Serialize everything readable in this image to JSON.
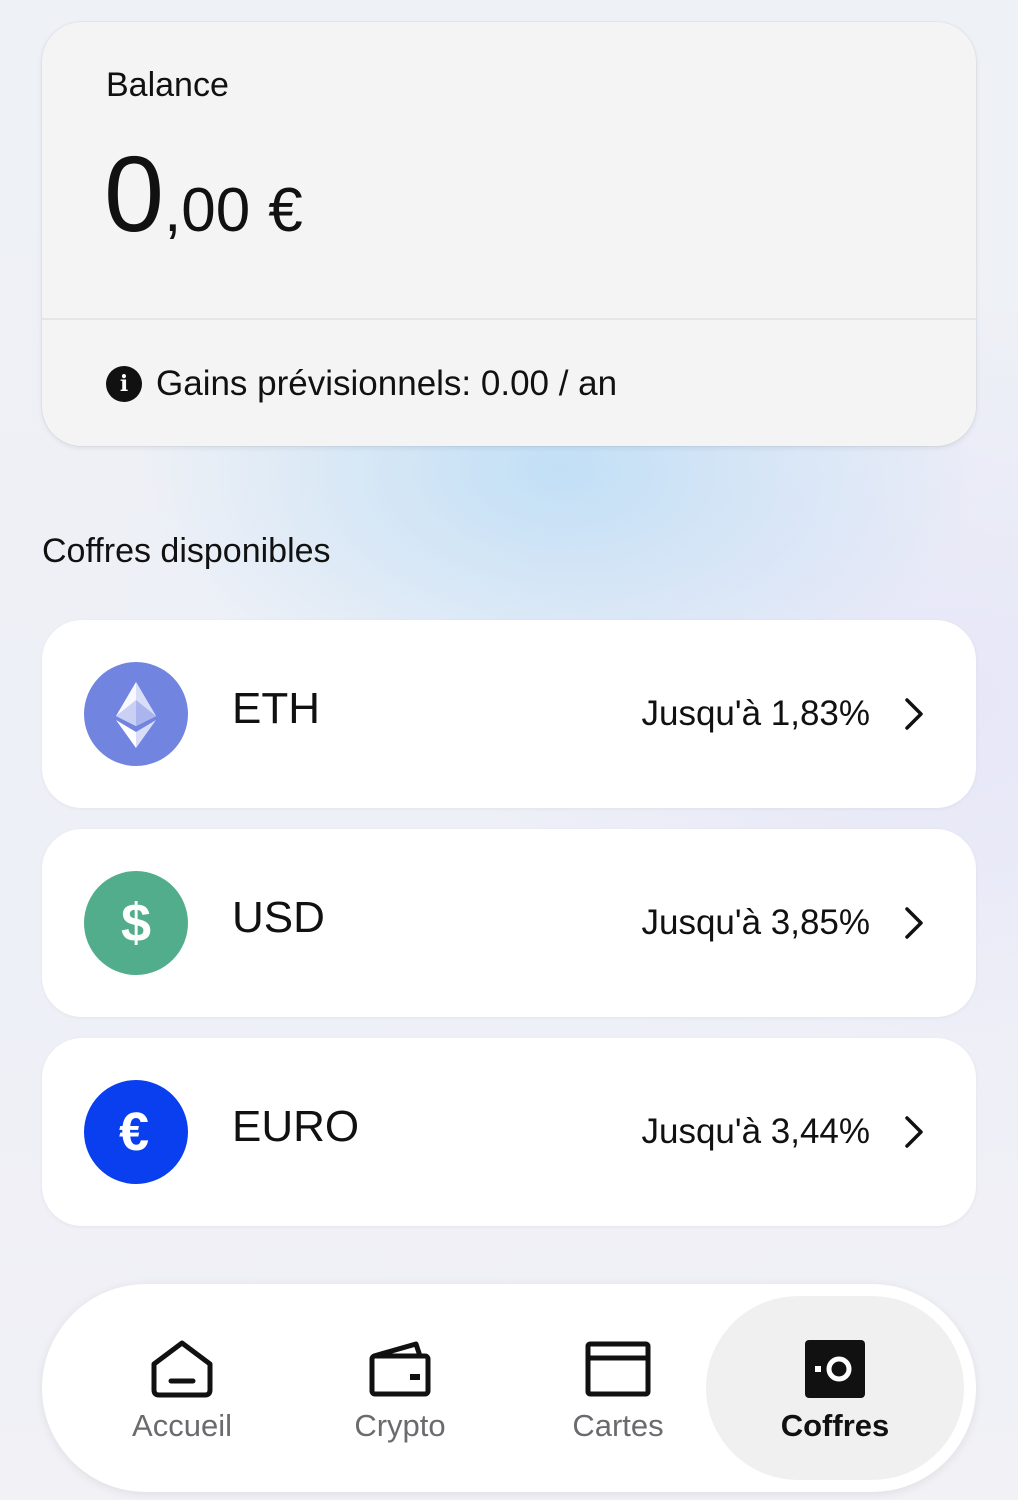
{
  "balance": {
    "label": "Balance",
    "amount_int": "0",
    "amount_dec": ",00",
    "currency": "€",
    "gains_text": "Gains prévisionnels: 0.00 / an",
    "info_icon": "info-icon"
  },
  "vaults": {
    "title": "Coffres disponibles",
    "items": [
      {
        "name": "ETH",
        "rate": "Jusqu'à 1,83%",
        "icon": "ethereum-icon",
        "color": "#7185e0"
      },
      {
        "name": "USD",
        "rate": "Jusqu'à 3,85%",
        "icon": "dollar-icon",
        "color": "#52ad8c"
      },
      {
        "name": "EURO",
        "rate": "Jusqu'à 3,44%",
        "icon": "euro-icon",
        "color": "#0a3ff0"
      }
    ]
  },
  "nav": {
    "items": [
      {
        "label": "Accueil",
        "icon": "home-icon",
        "active": false
      },
      {
        "label": "Crypto",
        "icon": "wallet-icon",
        "active": false
      },
      {
        "label": "Cartes",
        "icon": "card-icon",
        "active": false
      },
      {
        "label": "Coffres",
        "icon": "vault-icon",
        "active": true
      }
    ]
  }
}
